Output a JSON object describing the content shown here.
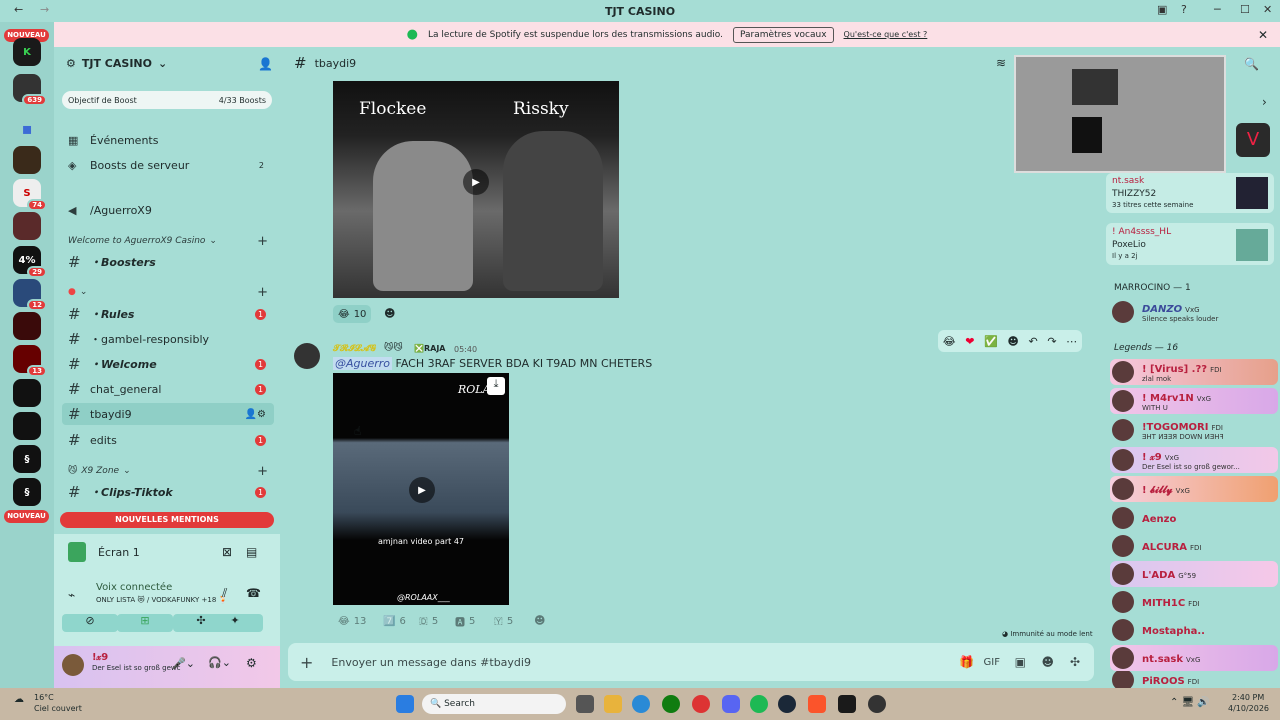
{
  "window": {
    "title": "TJT CASINO"
  },
  "guilds": {
    "nouveau_top": "NOUVEAU",
    "nouveau_bottom": "NOUVEAU",
    "badges": [
      "639",
      "74",
      "29",
      "12",
      "13"
    ]
  },
  "server": {
    "name": "TJT CASINO",
    "boost_label": "Objectif de Boost",
    "boost_count": "4/33 Boosts"
  },
  "sidebar": {
    "events": "Événements",
    "boosts": "Boosts de serveur",
    "boosts_count": "2",
    "vanity": "/AguerroX9",
    "cat1": "Welcome to AguerroX9 Casino",
    "ch_boosters": "・Boosters",
    "cat2": "⌄",
    "ch_rules": "・Rules",
    "ch_gambel": "・gambel-responsibly",
    "ch_welcome": "・Welcome",
    "ch_general": "chat_general",
    "ch_tbaydi": "tbaydi9",
    "ch_edits": "edits",
    "cat3": "X9 Zone",
    "ch_clips": "・Clips-Tiktok",
    "unread": "1"
  },
  "mentions": "NOUVELLES MENTIONS",
  "voice": {
    "screen": "Écran 1",
    "connected": "Voix connectée",
    "channel": "ONLY LISTA 😻 / VODKAFUNKY +18 🍹",
    "user": "!𝓍9",
    "status": "Der Esel ist so groß gewc"
  },
  "spotify": {
    "text": "La lecture de Spotify est suspendue lors des transmissions audio.",
    "btn": "Paramètres vocaux",
    "link": "Qu'est-ce que c'est ?"
  },
  "channel_header": {
    "name": "tbaydi9"
  },
  "messages": {
    "video1": {
      "left": "Flockee",
      "right": "Rissky"
    },
    "react1": [
      {
        "emoji": "😂",
        "count": "10"
      }
    ],
    "author": "𝓣𝓡𝓘𝓛𝓐𝓖",
    "role": "RAJA",
    "time": "05:40",
    "mention": "@Aguerro",
    "text": "FACH 3RAF SERVER BDA KI T9AD MN CHETERS",
    "video2": {
      "caption": "amjnan video part 47",
      "watermark": "@ROLAAX___"
    },
    "react2": [
      {
        "emoji": "😂",
        "count": "13"
      },
      {
        "emoji": "7️⃣",
        "count": "6"
      },
      {
        "emoji": "🇩",
        "count": "5"
      },
      {
        "emoji": "🅰",
        "count": "5"
      },
      {
        "emoji": "🇾",
        "count": "5"
      }
    ],
    "slowmode": "Immunité au mode lent"
  },
  "composer": {
    "placeholder": "Envoyer un message dans #tbaydi9"
  },
  "members": {
    "activity": [
      {
        "name": "nt.sask",
        "line1": "THIZZY52",
        "line2": "33 titres cette semaine"
      },
      {
        "name": "! An4ssss_HL",
        "line1": "PoxeLio",
        "line2": "Il y a 2j"
      }
    ],
    "cat1": "MARROCINO — 1",
    "danzo": {
      "name": "DANZO",
      "tag": "VxG",
      "status": "Silence speaks louder"
    },
    "cat2": "Legends — 16",
    "list": [
      {
        "name": "! [Virus] .??",
        "tag": "FDI",
        "status": "zlal mok"
      },
      {
        "name": "! M4rv1N",
        "tag": "VxG",
        "status": "WITH U"
      },
      {
        "name": "!TOGOMORI",
        "tag": "FDI",
        "status": "ƎHT ИƎƎЯ DOWN ИƎHꟻ"
      },
      {
        "name": "! 𝓍9",
        "tag": "VxG",
        "status": "Der Esel ist so groß gewor..."
      },
      {
        "name": "! 𝓫𝓲𝓵𝓵𝔂",
        "tag": "VxG",
        "status": ""
      },
      {
        "name": "Aenzo",
        "tag": "",
        "status": ""
      },
      {
        "name": "ALCURA",
        "tag": "FDI",
        "status": ""
      },
      {
        "name": "L'ADA",
        "tag": "G°59",
        "status": ""
      },
      {
        "name": "MITH1C",
        "tag": "FDI",
        "status": ""
      },
      {
        "name": "Mostapha..",
        "tag": "",
        "status": ""
      },
      {
        "name": "nt.sask",
        "tag": "VxG",
        "status": ""
      },
      {
        "name": "PiROOS",
        "tag": "FDI",
        "status": ""
      }
    ]
  },
  "taskbar": {
    "temp": "16°C",
    "weather": "Ciel couvert",
    "search": "Search",
    "time": "2:40 PM",
    "date": "4/10/2026"
  }
}
